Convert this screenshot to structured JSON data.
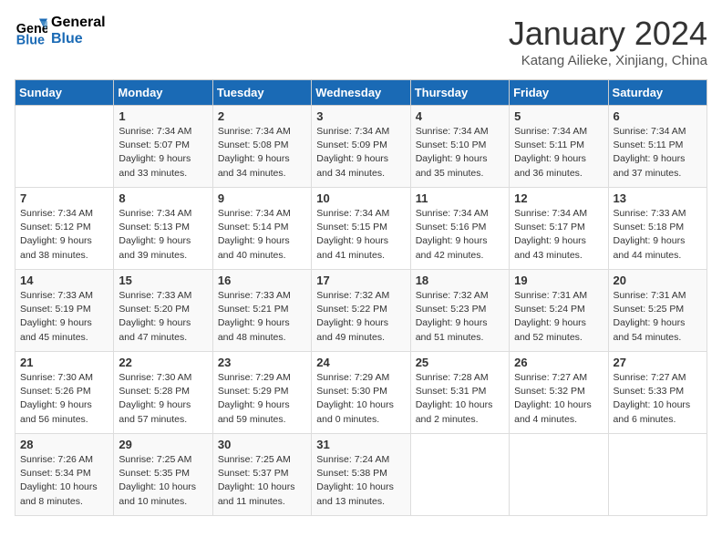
{
  "header": {
    "logo_line1": "General",
    "logo_line2": "Blue",
    "month_title": "January 2024",
    "subtitle": "Katang Ailieke, Xinjiang, China"
  },
  "days_of_week": [
    "Sunday",
    "Monday",
    "Tuesday",
    "Wednesday",
    "Thursday",
    "Friday",
    "Saturday"
  ],
  "weeks": [
    [
      {
        "day": "",
        "info": ""
      },
      {
        "day": "1",
        "info": "Sunrise: 7:34 AM\nSunset: 5:07 PM\nDaylight: 9 hours\nand 33 minutes."
      },
      {
        "day": "2",
        "info": "Sunrise: 7:34 AM\nSunset: 5:08 PM\nDaylight: 9 hours\nand 34 minutes."
      },
      {
        "day": "3",
        "info": "Sunrise: 7:34 AM\nSunset: 5:09 PM\nDaylight: 9 hours\nand 34 minutes."
      },
      {
        "day": "4",
        "info": "Sunrise: 7:34 AM\nSunset: 5:10 PM\nDaylight: 9 hours\nand 35 minutes."
      },
      {
        "day": "5",
        "info": "Sunrise: 7:34 AM\nSunset: 5:11 PM\nDaylight: 9 hours\nand 36 minutes."
      },
      {
        "day": "6",
        "info": "Sunrise: 7:34 AM\nSunset: 5:11 PM\nDaylight: 9 hours\nand 37 minutes."
      }
    ],
    [
      {
        "day": "7",
        "info": "Sunrise: 7:34 AM\nSunset: 5:12 PM\nDaylight: 9 hours\nand 38 minutes."
      },
      {
        "day": "8",
        "info": "Sunrise: 7:34 AM\nSunset: 5:13 PM\nDaylight: 9 hours\nand 39 minutes."
      },
      {
        "day": "9",
        "info": "Sunrise: 7:34 AM\nSunset: 5:14 PM\nDaylight: 9 hours\nand 40 minutes."
      },
      {
        "day": "10",
        "info": "Sunrise: 7:34 AM\nSunset: 5:15 PM\nDaylight: 9 hours\nand 41 minutes."
      },
      {
        "day": "11",
        "info": "Sunrise: 7:34 AM\nSunset: 5:16 PM\nDaylight: 9 hours\nand 42 minutes."
      },
      {
        "day": "12",
        "info": "Sunrise: 7:34 AM\nSunset: 5:17 PM\nDaylight: 9 hours\nand 43 minutes."
      },
      {
        "day": "13",
        "info": "Sunrise: 7:33 AM\nSunset: 5:18 PM\nDaylight: 9 hours\nand 44 minutes."
      }
    ],
    [
      {
        "day": "14",
        "info": "Sunrise: 7:33 AM\nSunset: 5:19 PM\nDaylight: 9 hours\nand 45 minutes."
      },
      {
        "day": "15",
        "info": "Sunrise: 7:33 AM\nSunset: 5:20 PM\nDaylight: 9 hours\nand 47 minutes."
      },
      {
        "day": "16",
        "info": "Sunrise: 7:33 AM\nSunset: 5:21 PM\nDaylight: 9 hours\nand 48 minutes."
      },
      {
        "day": "17",
        "info": "Sunrise: 7:32 AM\nSunset: 5:22 PM\nDaylight: 9 hours\nand 49 minutes."
      },
      {
        "day": "18",
        "info": "Sunrise: 7:32 AM\nSunset: 5:23 PM\nDaylight: 9 hours\nand 51 minutes."
      },
      {
        "day": "19",
        "info": "Sunrise: 7:31 AM\nSunset: 5:24 PM\nDaylight: 9 hours\nand 52 minutes."
      },
      {
        "day": "20",
        "info": "Sunrise: 7:31 AM\nSunset: 5:25 PM\nDaylight: 9 hours\nand 54 minutes."
      }
    ],
    [
      {
        "day": "21",
        "info": "Sunrise: 7:30 AM\nSunset: 5:26 PM\nDaylight: 9 hours\nand 56 minutes."
      },
      {
        "day": "22",
        "info": "Sunrise: 7:30 AM\nSunset: 5:28 PM\nDaylight: 9 hours\nand 57 minutes."
      },
      {
        "day": "23",
        "info": "Sunrise: 7:29 AM\nSunset: 5:29 PM\nDaylight: 9 hours\nand 59 minutes."
      },
      {
        "day": "24",
        "info": "Sunrise: 7:29 AM\nSunset: 5:30 PM\nDaylight: 10 hours\nand 0 minutes."
      },
      {
        "day": "25",
        "info": "Sunrise: 7:28 AM\nSunset: 5:31 PM\nDaylight: 10 hours\nand 2 minutes."
      },
      {
        "day": "26",
        "info": "Sunrise: 7:27 AM\nSunset: 5:32 PM\nDaylight: 10 hours\nand 4 minutes."
      },
      {
        "day": "27",
        "info": "Sunrise: 7:27 AM\nSunset: 5:33 PM\nDaylight: 10 hours\nand 6 minutes."
      }
    ],
    [
      {
        "day": "28",
        "info": "Sunrise: 7:26 AM\nSunset: 5:34 PM\nDaylight: 10 hours\nand 8 minutes."
      },
      {
        "day": "29",
        "info": "Sunrise: 7:25 AM\nSunset: 5:35 PM\nDaylight: 10 hours\nand 10 minutes."
      },
      {
        "day": "30",
        "info": "Sunrise: 7:25 AM\nSunset: 5:37 PM\nDaylight: 10 hours\nand 11 minutes."
      },
      {
        "day": "31",
        "info": "Sunrise: 7:24 AM\nSunset: 5:38 PM\nDaylight: 10 hours\nand 13 minutes."
      },
      {
        "day": "",
        "info": ""
      },
      {
        "day": "",
        "info": ""
      },
      {
        "day": "",
        "info": ""
      }
    ]
  ]
}
